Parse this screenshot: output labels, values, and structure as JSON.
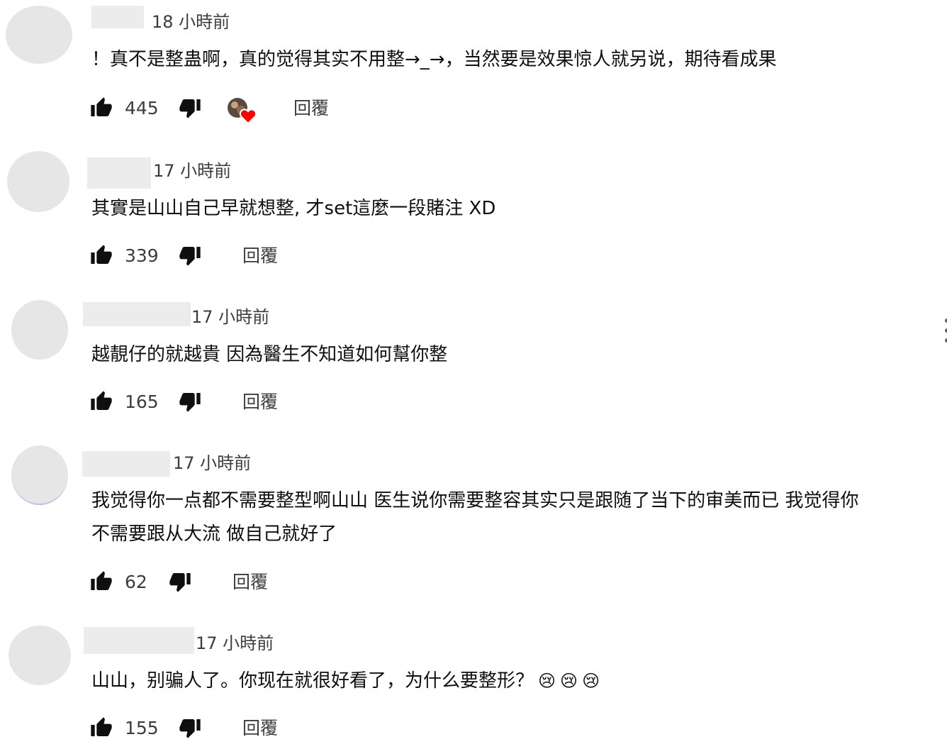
{
  "comments": [
    {
      "time": "18 小時前",
      "text": "！真不是整蛊啊，真的觉得其实不用整→_→，当然要是效果惊人就另说，期待看成果",
      "likes": "445",
      "reply": "回覆",
      "creator_hearted": true
    },
    {
      "time": "17 小時前",
      "text": "其實是山山自己早就想整, 才set這麼一段賭注 XD",
      "likes": "339",
      "reply": "回覆"
    },
    {
      "time": "17 小時前",
      "text": "越靚仔的就越貴 因為醫生不知道如何幫你整",
      "likes": "165",
      "reply": "回覆"
    },
    {
      "time": "17 小時前",
      "text_line1": "我觉得你一点都不需要整型啊山山 医生说你需要整容其实只是跟随了当下的审美而已 我觉得你",
      "text_line2": "不需要跟从大流 做自己就好了",
      "likes": "62",
      "reply": "回覆"
    },
    {
      "time": "17 小時前",
      "text": "山山，别骗人了。你现在就很好看了，为什么要整形？",
      "emojis": [
        "😢",
        "😢",
        "😢"
      ],
      "likes": "155",
      "reply": "回覆"
    }
  ]
}
